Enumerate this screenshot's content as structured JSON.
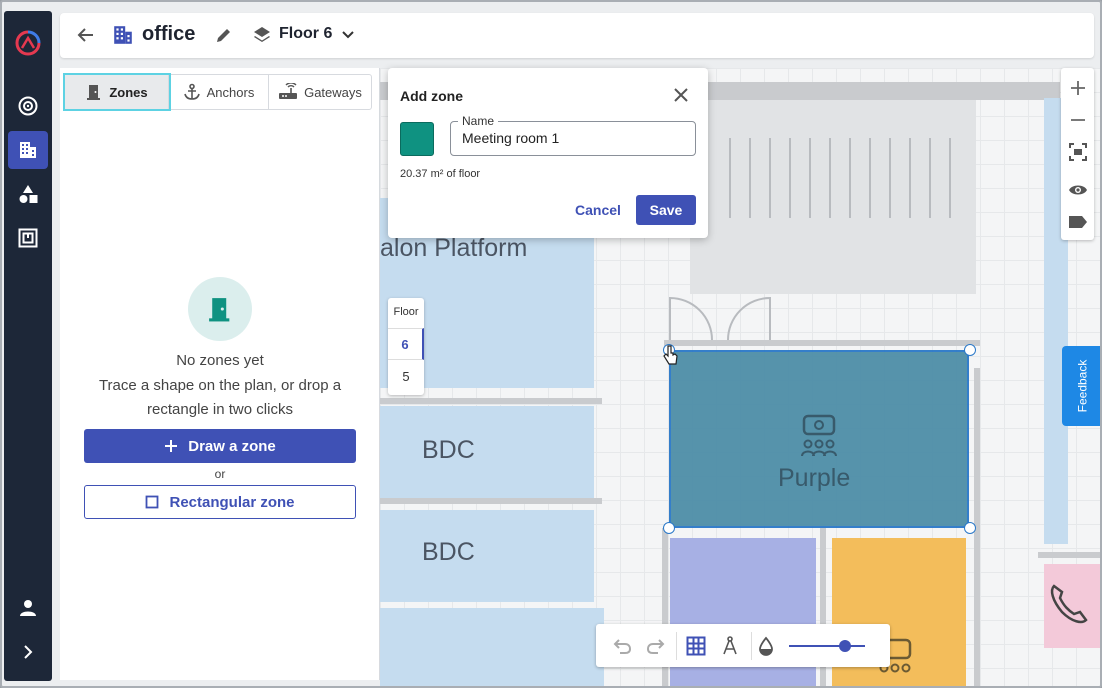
{
  "header": {
    "building_name": "office",
    "floor_selector": "Floor 6",
    "icons": [
      "arrow-back-icon",
      "building-icon",
      "pencil-icon",
      "layers-icon",
      "chevron-down-icon"
    ]
  },
  "leftnav": {
    "items": [
      {
        "name": "logo",
        "icon": "app-logo-icon"
      },
      {
        "name": "positioning",
        "icon": "target-icon"
      },
      {
        "name": "buildings",
        "icon": "building-icon",
        "active": true
      },
      {
        "name": "shapes",
        "icon": "shapes-icon"
      },
      {
        "name": "floorplans",
        "icon": "floorplan-icon"
      },
      {
        "name": "account",
        "icon": "person-icon"
      },
      {
        "name": "expand",
        "icon": "chevron-right-icon"
      }
    ]
  },
  "panel": {
    "tabs": [
      {
        "label": "Zones",
        "icon": "door-icon",
        "active": true
      },
      {
        "label": "Anchors",
        "icon": "anchor-icon"
      },
      {
        "label": "Gateways",
        "icon": "router-icon"
      }
    ],
    "empty_title": "No zones yet",
    "empty_text": "Trace a shape on the plan, or drop a rectangle in two clicks",
    "draw_button": "Draw a zone",
    "or_text": "or",
    "rect_button": "Rectangular zone"
  },
  "dialog": {
    "title": "Add zone",
    "name_label": "Name",
    "name_value": "Meeting room 1",
    "color": "#0f9281",
    "area_text": "20.37 m² of floor",
    "cancel": "Cancel",
    "save": "Save"
  },
  "floor_switch": {
    "header": "Floor",
    "floors": [
      "6",
      "5"
    ],
    "active": "6"
  },
  "map": {
    "labels": {
      "platform": "alon Platform",
      "bdc1": "BDC",
      "bdc2": "BDC",
      "purple": "Purple"
    }
  },
  "feedback": "Feedback",
  "colors": {
    "accent": "#3f51b5",
    "nav_bg": "#1d2738",
    "zone_teal": "#0f9281",
    "room_blue": "#c5dcef",
    "room_purple": "#a7b0e4",
    "room_orange": "#f3bd5b",
    "room_pink": "#f3c9d9"
  }
}
